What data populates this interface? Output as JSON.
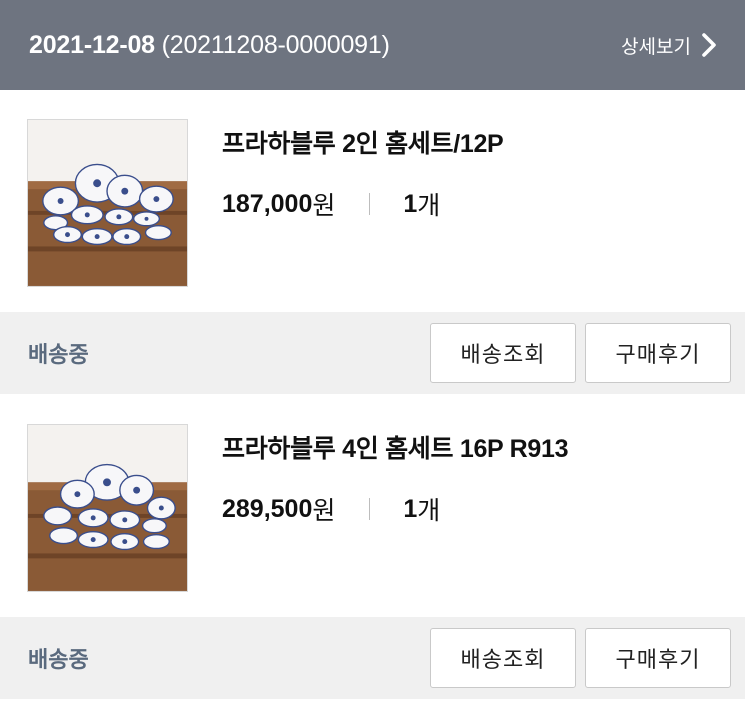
{
  "order": {
    "date": "2021-12-08",
    "number": "(20211208-0000091)",
    "detail_label": "상세보기"
  },
  "items": [
    {
      "name": "프라하블루 2인 홈세트/12P",
      "price": "187,000",
      "price_unit": "원",
      "qty": "1",
      "qty_unit": "개",
      "status": "배송중",
      "track_label": "배송조회",
      "review_label": "구매후기"
    },
    {
      "name": "프라하블루 4인 홈세트 16P R913",
      "price": "289,500",
      "price_unit": "원",
      "qty": "1",
      "qty_unit": "개",
      "status": "배송중",
      "track_label": "배송조회",
      "review_label": "구매후기"
    }
  ],
  "colors": {
    "header_bg": "#6e7480",
    "status_bg": "#f0f0f0",
    "status_text": "#5a6a7e"
  }
}
